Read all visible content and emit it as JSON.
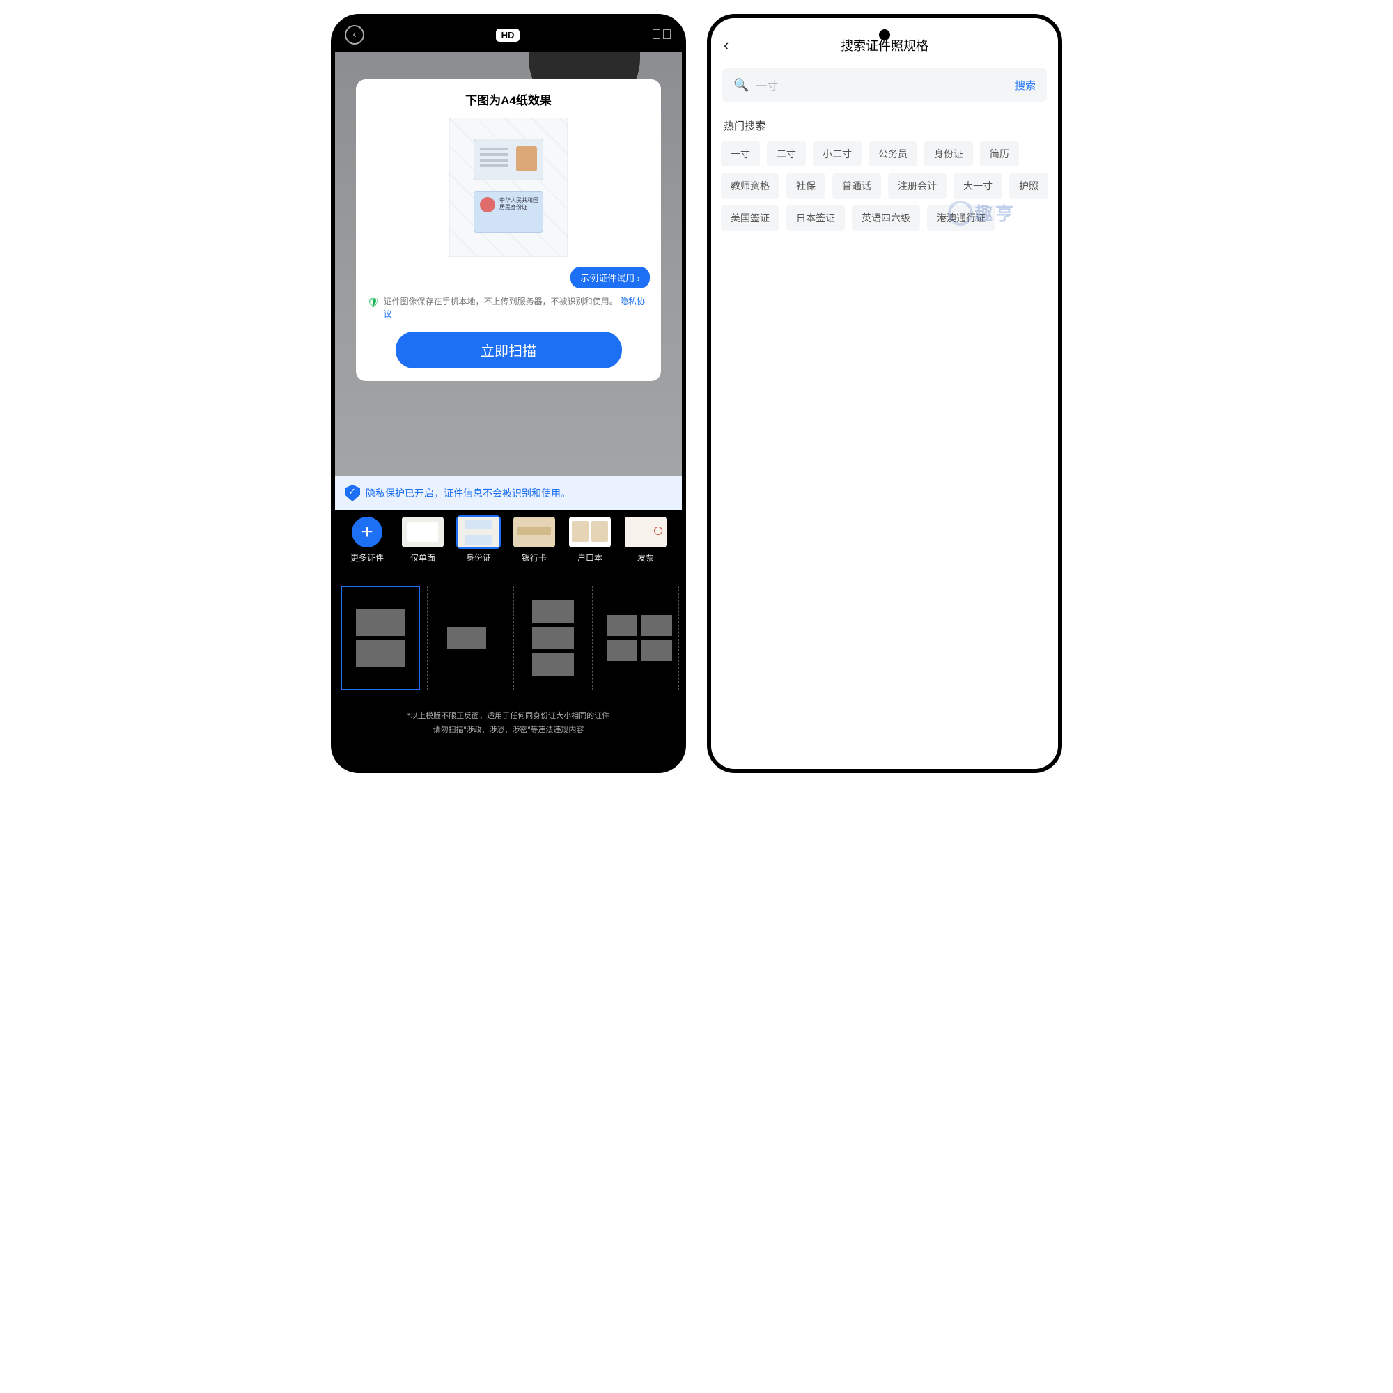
{
  "left": {
    "hd": "HD",
    "dialog_title": "下图为A4纸效果",
    "try_btn": "示例证件试用",
    "privacy_text": "证件图像保存在手机本地，不上传到服务器，不被识别和使用。",
    "privacy_link": "隐私协议",
    "scan_now": "立即扫描",
    "banner": "隐私保护已开启，证件信息不会被识别和使用。",
    "docs": [
      {
        "label": "更多证件",
        "kind": "plus"
      },
      {
        "label": "仅单面",
        "kind": "single"
      },
      {
        "label": "身份证",
        "kind": "idcard",
        "selected": true
      },
      {
        "label": "银行卡",
        "kind": "bank"
      },
      {
        "label": "户口本",
        "kind": "hukou"
      },
      {
        "label": "发票",
        "kind": "invoice"
      }
    ],
    "foot_line1": "*以上模版不限正反面，适用于任何同身份证大小相同的证件",
    "foot_line2": "请勿扫描\"涉政、涉恐、涉密\"等违法违规内容"
  },
  "right": {
    "title": "搜索证件照规格",
    "query": "一寸",
    "search_btn": "搜索",
    "section": "热门搜索",
    "chips": [
      "一寸",
      "二寸",
      "小二寸",
      "公务员",
      "身份证",
      "简历",
      "教师资格",
      "社保",
      "普通话",
      "注册会计",
      "大一寸",
      "护照",
      "美国签证",
      "日本签证",
      "英语四六级",
      "港澳通行证"
    ],
    "watermark": "趣亨"
  }
}
